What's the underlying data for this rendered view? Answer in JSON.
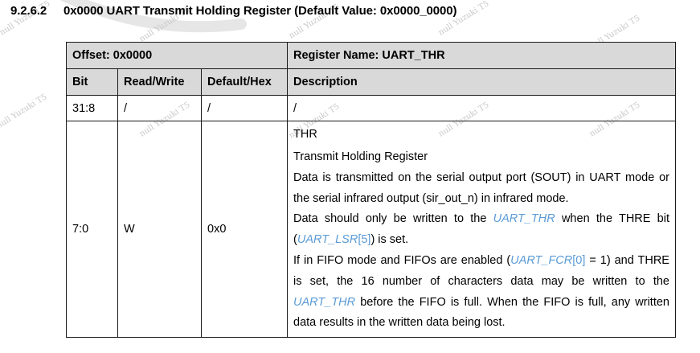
{
  "section": {
    "number": "9.2.6.2",
    "title": "0x0000 UART Transmit Holding Register (Default Value: 0x0000_0000)"
  },
  "table": {
    "offset_label": "Offset: 0x0000",
    "register_name_label": "Register Name: UART_THR",
    "columns": [
      "Bit",
      "Read/Write",
      "Default/Hex",
      "Description"
    ],
    "rows": [
      {
        "bit": "31:8",
        "rw": "/",
        "default": "/",
        "description": "/"
      },
      {
        "bit": "7:0",
        "rw": "W",
        "default": "0x0",
        "field_name": "THR",
        "field_title": "Transmit Holding Register",
        "para1": "Data is transmitted on the serial output port (SOUT) in UART mode or the serial infrared output (sir_out_n) in infrared mode.",
        "para2_a": "Data should only be written to the ",
        "para2_link1": "UART_THR",
        "para2_b": " when the THRE bit (",
        "para2_link2": "UART_LSR",
        "para2_link2_idx": "[5]",
        "para2_c": ") is set.",
        "para3_a": "If in FIFO mode and FIFOs are enabled (",
        "para3_link1": "UART_FCR",
        "para3_link1_idx": "[0]",
        "para3_b": " = 1) and THRE is set, the 16 number of characters data may be written to the ",
        "para3_link2": "UART_THR",
        "para3_c": " before the FIFO is full. When the FIFO is full, any written data results in the written data being lost."
      }
    ]
  },
  "watermark_text": "null Yuzuki T5",
  "colors": {
    "header_bg": "#d9d9d9",
    "link": "#5b9bd5",
    "watermark": "#c8c8c8"
  }
}
